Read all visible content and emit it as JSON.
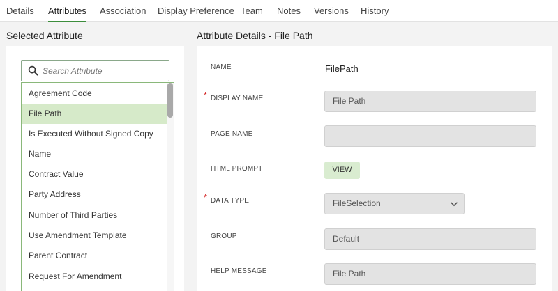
{
  "tabs": [
    {
      "label": "Details"
    },
    {
      "label": "Attributes"
    },
    {
      "label": "Association"
    },
    {
      "label": "Display Preference"
    },
    {
      "label": "Team"
    },
    {
      "label": "Notes"
    },
    {
      "label": "Versions"
    },
    {
      "label": "History"
    }
  ],
  "active_tab": "Attributes",
  "left": {
    "title": "Selected Attribute",
    "search_placeholder": "Search Attribute",
    "items": [
      {
        "label": "Agreement Code"
      },
      {
        "label": "File Path"
      },
      {
        "label": "Is Executed Without Signed Copy"
      },
      {
        "label": "Name"
      },
      {
        "label": "Contract Value"
      },
      {
        "label": "Party Address"
      },
      {
        "label": "Number of Third Parties"
      },
      {
        "label": "Use Amendment Template"
      },
      {
        "label": "Parent Contract"
      },
      {
        "label": "Request For Amendment"
      }
    ],
    "selected_item": "File Path"
  },
  "right": {
    "title": "Attribute Details - File Path",
    "fields": {
      "name": {
        "label": "NAME",
        "value": "FilePath"
      },
      "display_name": {
        "label": "DISPLAY NAME",
        "value": "File Path",
        "required_mark": "*"
      },
      "page_name": {
        "label": "PAGE NAME",
        "value": ""
      },
      "html_prompt": {
        "label": "HTML PROMPT",
        "button": "VIEW"
      },
      "data_type": {
        "label": "DATA TYPE",
        "value": "FileSelection",
        "required_mark": "*"
      },
      "group": {
        "label": "GROUP",
        "value": "Default"
      },
      "help_message": {
        "label": "HELP MESSAGE",
        "value": "File Path"
      }
    }
  },
  "colors": {
    "accent": "#3c8d3c",
    "selected_row": "#d6eac9",
    "required": "#d32020"
  }
}
